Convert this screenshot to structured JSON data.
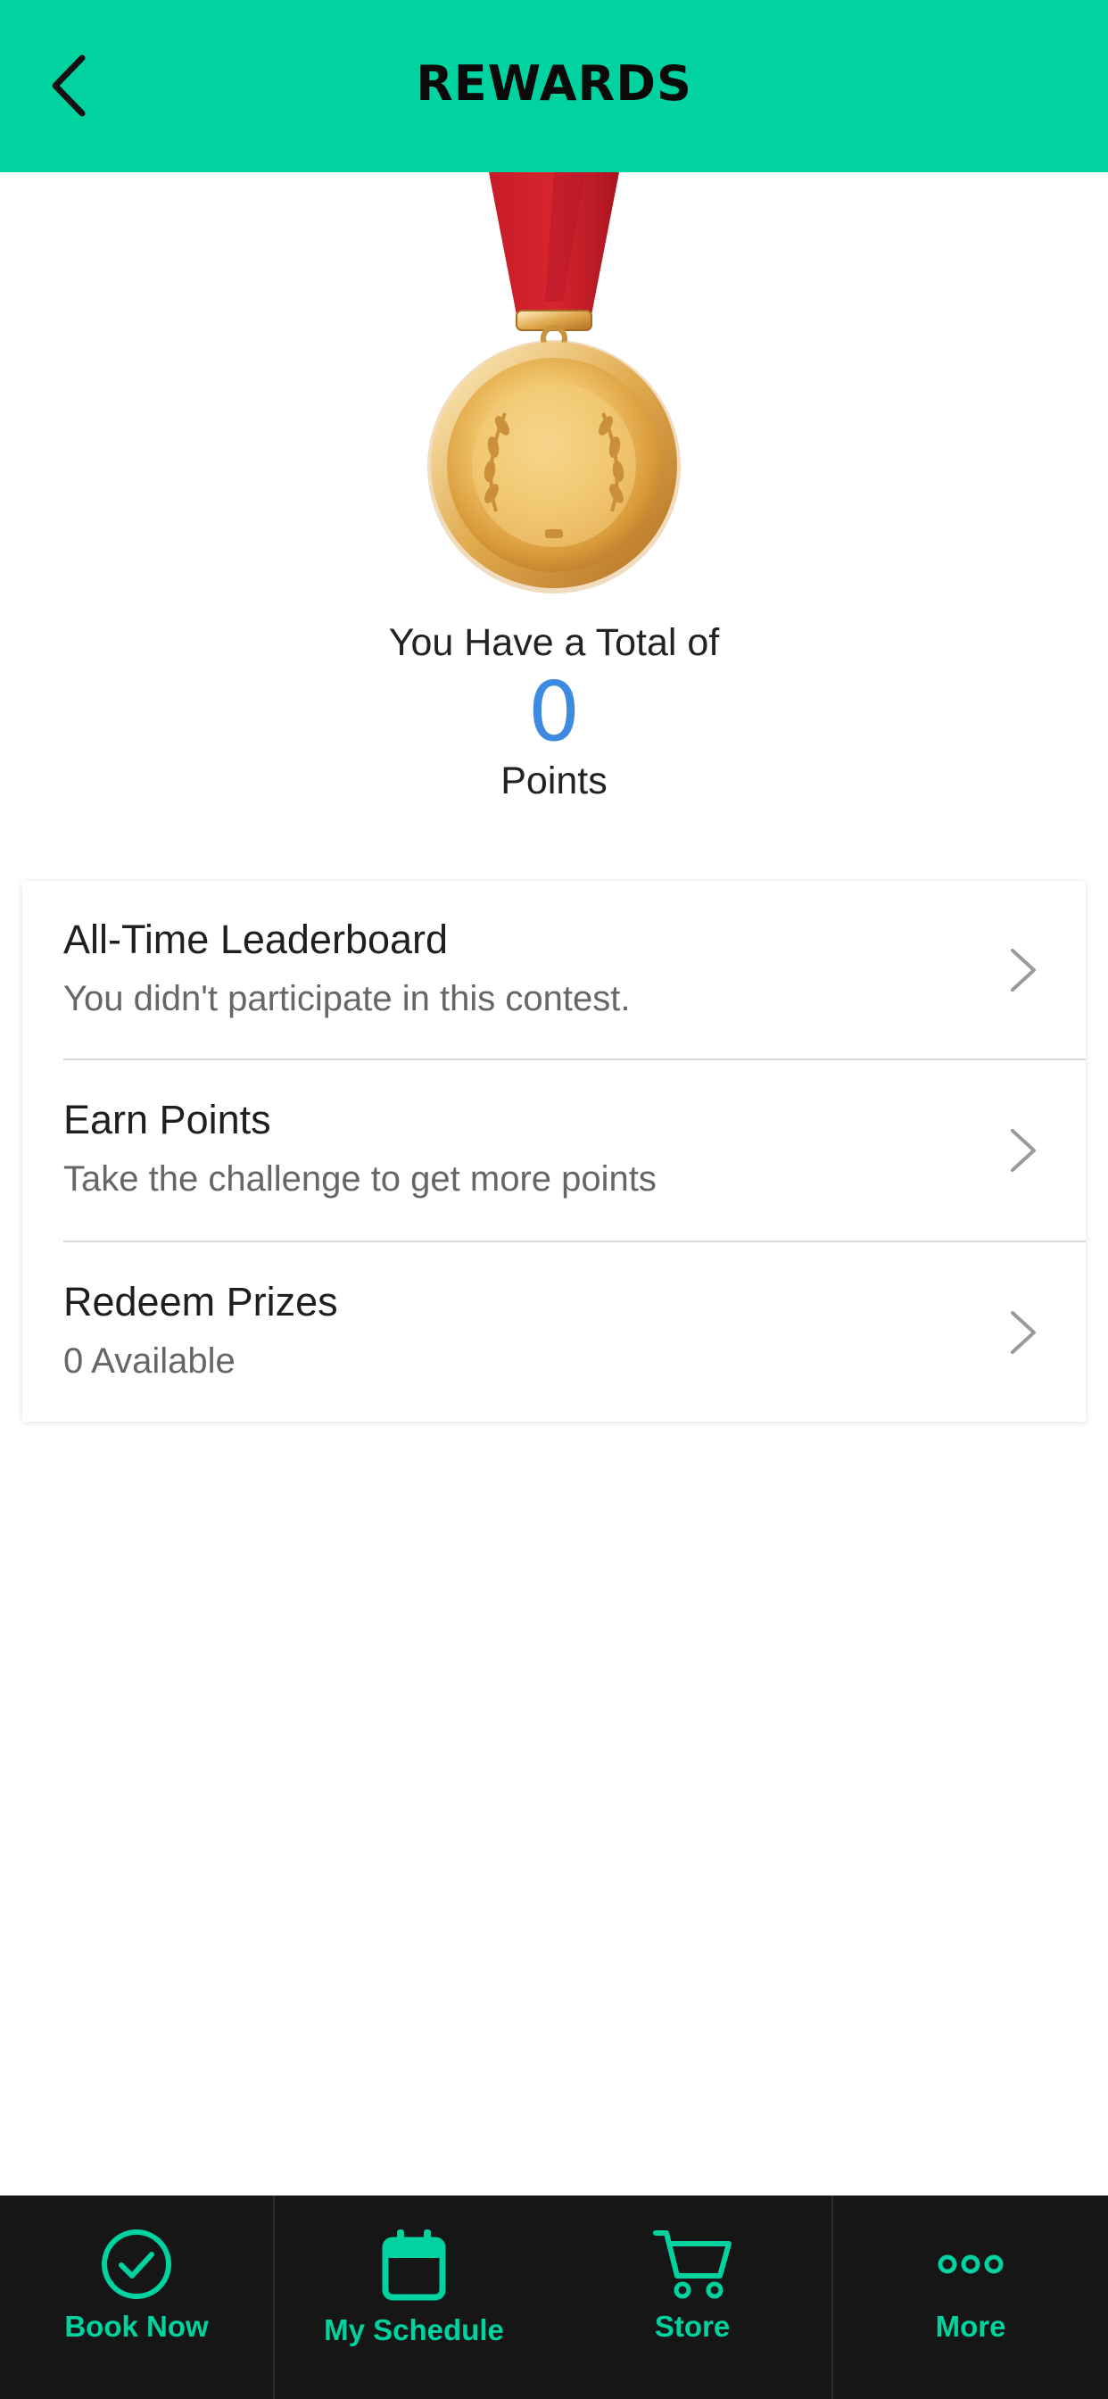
{
  "header": {
    "title": "REWARDS",
    "back_icon": "chevron-left-icon",
    "color": "#00d2a0"
  },
  "summary": {
    "total_label": "You Have a Total of",
    "points_value": "0",
    "points_label": "Points",
    "value_color": "#3c8be0",
    "medal_icon": "gold-medal-icon"
  },
  "list": [
    {
      "title": "All-Time Leaderboard",
      "subtitle": "You didn't participate in this contest."
    },
    {
      "title": "Earn Points",
      "subtitle": "Take the challenge to get more points"
    },
    {
      "title": "Redeem Prizes",
      "subtitle": "0 Available"
    }
  ],
  "tabbar": {
    "accent": "#00d2a0",
    "background": "#161616",
    "tabs": [
      {
        "label": "Book Now",
        "icon": "check-circle-icon"
      },
      {
        "label": "My Schedule",
        "icon": "calendar-icon"
      },
      {
        "label": "Store",
        "icon": "cart-icon"
      },
      {
        "label": "More",
        "icon": "more-dots-icon"
      }
    ]
  }
}
